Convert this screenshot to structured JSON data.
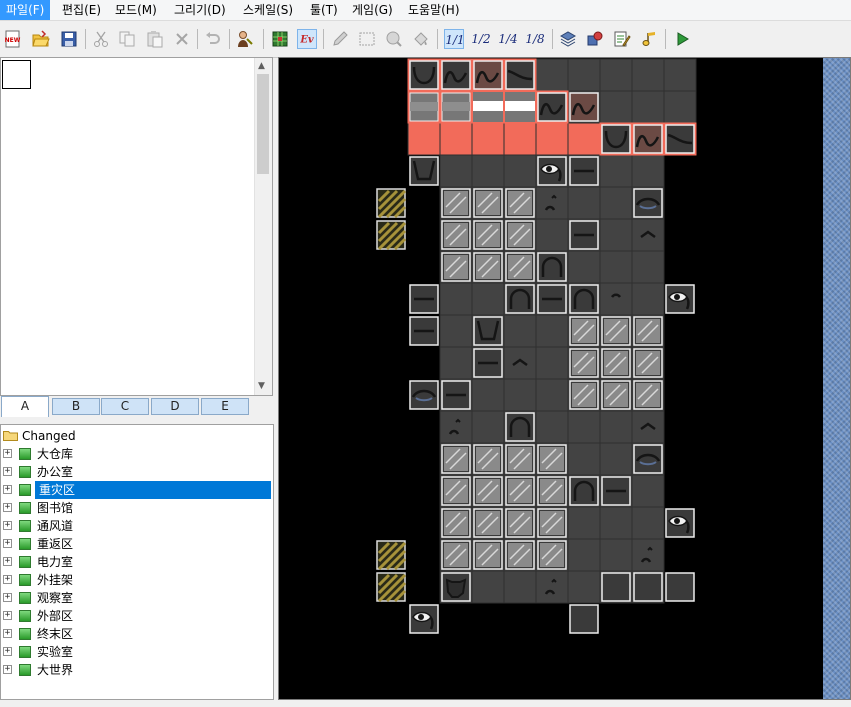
{
  "menubar": {
    "items": [
      {
        "label": "파일(F)",
        "active": true
      },
      {
        "label": "편집(E)"
      },
      {
        "label": "모드(M)"
      },
      {
        "label": "그리기(D)"
      },
      {
        "label": "스케일(S)"
      },
      {
        "label": "툴(T)"
      },
      {
        "label": "게임(G)"
      },
      {
        "label": "도움말(H)"
      }
    ]
  },
  "toolbar": {
    "new_label": "NEW",
    "event_label": "Ev",
    "scale_full": "1/1",
    "scale_half": "1/2",
    "scale_quarter": "1/4",
    "scale_eighth": "1/8"
  },
  "tabs": [
    "A",
    "B",
    "C",
    "D",
    "E"
  ],
  "tree": {
    "root": "Changed",
    "items": [
      "大仓库",
      "办公室",
      "重灾区",
      "图书馆",
      "通风道",
      "重返区",
      "电力室",
      "外挂架",
      "观察室",
      "外部区",
      "终末区",
      "实验室",
      "大世界"
    ],
    "selected_index": 2
  },
  "map": {
    "grid": {
      "cols": 9,
      "rows": 18,
      "cell": 32
    },
    "colors": {
      "background": "#000000",
      "floor": "#434343",
      "grid_line": "#2f2f2f",
      "highlight": "#f26b5a",
      "panel_stripe": "#6a8fc4"
    },
    "blank_cells": [
      [
        0,
        1
      ],
      [
        1,
        1
      ],
      [
        2,
        1
      ],
      [
        0,
        3
      ],
      [
        0,
        4
      ],
      [
        0,
        5
      ],
      [
        0,
        6
      ],
      [
        0,
        7
      ],
      [
        0,
        8
      ],
      [
        0,
        9
      ],
      [
        0,
        10
      ],
      [
        0,
        11
      ],
      [
        0,
        12
      ],
      [
        0,
        13
      ],
      [
        0,
        14
      ],
      [
        0,
        15
      ],
      [
        0,
        16
      ],
      [
        0,
        17
      ],
      [
        1,
        17
      ],
      [
        2,
        17
      ],
      [
        3,
        17
      ],
      [
        4,
        17
      ],
      [
        5,
        17
      ],
      [
        6,
        17
      ],
      [
        7,
        17
      ],
      [
        8,
        17
      ],
      [
        8,
        2
      ],
      [
        8,
        3
      ],
      [
        8,
        4
      ],
      [
        8,
        5
      ],
      [
        8,
        6
      ],
      [
        8,
        7
      ],
      [
        8,
        8
      ],
      [
        8,
        9
      ],
      [
        8,
        10
      ],
      [
        8,
        11
      ],
      [
        8,
        12
      ],
      [
        8,
        13
      ],
      [
        8,
        14
      ],
      [
        8,
        15
      ],
      [
        8,
        16
      ]
    ],
    "red_cells": [
      [
        0,
        2
      ],
      [
        1,
        2
      ],
      [
        2,
        2
      ],
      [
        3,
        2
      ],
      [
        4,
        2
      ],
      [
        5,
        2
      ]
    ],
    "tiles": [
      {
        "c": 0,
        "r": 0,
        "t": "curve-l",
        "hl": true
      },
      {
        "c": 1,
        "r": 0,
        "t": "wave",
        "hl": true
      },
      {
        "c": 2,
        "r": 0,
        "t": "wave-brown",
        "hl": true
      },
      {
        "c": 3,
        "r": 0,
        "t": "slope",
        "hl": true
      },
      {
        "c": 0,
        "r": 1,
        "t": "bar",
        "hl": true
      },
      {
        "c": 1,
        "r": 1,
        "t": "bar",
        "hl": true
      },
      {
        "c": 2,
        "r": 1,
        "t": "white-band",
        "hl": true
      },
      {
        "c": 3,
        "r": 1,
        "t": "white-band",
        "hl": true
      },
      {
        "c": 4,
        "r": 1,
        "t": "wave",
        "hl": true
      },
      {
        "c": 5,
        "r": 1,
        "t": "wave-brown",
        "hl": false
      },
      {
        "c": 6,
        "r": 2,
        "t": "curve-l",
        "hl": true
      },
      {
        "c": 7,
        "r": 2,
        "t": "wave-brown",
        "hl": true
      },
      {
        "c": 8,
        "r": 2,
        "t": "slope",
        "hl": true
      },
      {
        "c": 0,
        "r": 3,
        "t": "cup"
      },
      {
        "c": 4,
        "r": 3,
        "t": "eye"
      },
      {
        "c": 5,
        "r": 3,
        "t": "hline"
      },
      {
        "c": 1,
        "r": 4,
        "t": "glass"
      },
      {
        "c": 2,
        "r": 4,
        "t": "glass"
      },
      {
        "c": 3,
        "r": 4,
        "t": "glass"
      },
      {
        "c": 4,
        "r": 4,
        "t": "dots"
      },
      {
        "c": 7,
        "r": 4,
        "t": "dome-blue"
      },
      {
        "c": 1,
        "r": 5,
        "t": "glass"
      },
      {
        "c": 2,
        "r": 5,
        "t": "glass"
      },
      {
        "c": 3,
        "r": 5,
        "t": "glass"
      },
      {
        "c": 5,
        "r": 5,
        "t": "hline"
      },
      {
        "c": 7,
        "r": 5,
        "t": "caret"
      },
      {
        "c": 1,
        "r": 6,
        "t": "glass"
      },
      {
        "c": 2,
        "r": 6,
        "t": "glass"
      },
      {
        "c": 3,
        "r": 6,
        "t": "glass"
      },
      {
        "c": 4,
        "r": 6,
        "t": "arch"
      },
      {
        "c": 0,
        "r": 7,
        "t": "hline"
      },
      {
        "c": 3,
        "r": 7,
        "t": "arch"
      },
      {
        "c": 4,
        "r": 7,
        "t": "hline"
      },
      {
        "c": 5,
        "r": 7,
        "t": "arch"
      },
      {
        "c": 6,
        "r": 7,
        "t": "tiny-arch"
      },
      {
        "c": 8,
        "r": 7,
        "t": "eye"
      },
      {
        "c": 0,
        "r": 8,
        "t": "hline"
      },
      {
        "c": 2,
        "r": 8,
        "t": "cup"
      },
      {
        "c": 5,
        "r": 8,
        "t": "glass"
      },
      {
        "c": 6,
        "r": 8,
        "t": "glass"
      },
      {
        "c": 7,
        "r": 8,
        "t": "glass"
      },
      {
        "c": 2,
        "r": 9,
        "t": "hline"
      },
      {
        "c": 3,
        "r": 9,
        "t": "caret"
      },
      {
        "c": 5,
        "r": 9,
        "t": "glass"
      },
      {
        "c": 6,
        "r": 9,
        "t": "glass"
      },
      {
        "c": 7,
        "r": 9,
        "t": "glass"
      },
      {
        "c": 0,
        "r": 10,
        "t": "dome-blue"
      },
      {
        "c": 1,
        "r": 10,
        "t": "hline"
      },
      {
        "c": 5,
        "r": 10,
        "t": "glass"
      },
      {
        "c": 6,
        "r": 10,
        "t": "glass"
      },
      {
        "c": 7,
        "r": 10,
        "t": "glass"
      },
      {
        "c": 1,
        "r": 11,
        "t": "dots"
      },
      {
        "c": 3,
        "r": 11,
        "t": "arch"
      },
      {
        "c": 7,
        "r": 11,
        "t": "caret"
      },
      {
        "c": 1,
        "r": 12,
        "t": "glass"
      },
      {
        "c": 2,
        "r": 12,
        "t": "glass"
      },
      {
        "c": 3,
        "r": 12,
        "t": "glass"
      },
      {
        "c": 4,
        "r": 12,
        "t": "glass"
      },
      {
        "c": 7,
        "r": 12,
        "t": "dome-blue"
      },
      {
        "c": 1,
        "r": 13,
        "t": "glass"
      },
      {
        "c": 2,
        "r": 13,
        "t": "glass"
      },
      {
        "c": 3,
        "r": 13,
        "t": "glass"
      },
      {
        "c": 4,
        "r": 13,
        "t": "glass"
      },
      {
        "c": 5,
        "r": 13,
        "t": "arch"
      },
      {
        "c": 6,
        "r": 13,
        "t": "hline"
      },
      {
        "c": 1,
        "r": 14,
        "t": "glass"
      },
      {
        "c": 2,
        "r": 14,
        "t": "glass"
      },
      {
        "c": 3,
        "r": 14,
        "t": "glass"
      },
      {
        "c": 4,
        "r": 14,
        "t": "glass"
      },
      {
        "c": 8,
        "r": 14,
        "t": "eye"
      },
      {
        "c": 1,
        "r": 15,
        "t": "glass"
      },
      {
        "c": 2,
        "r": 15,
        "t": "glass"
      },
      {
        "c": 3,
        "r": 15,
        "t": "glass"
      },
      {
        "c": 4,
        "r": 15,
        "t": "glass"
      },
      {
        "c": 7,
        "r": 15,
        "t": "dots"
      },
      {
        "c": 1,
        "r": 16,
        "t": "blob"
      },
      {
        "c": 4,
        "r": 16,
        "t": "dots"
      },
      {
        "c": 6,
        "r": 16,
        "t": "empty-box"
      },
      {
        "c": 7,
        "r": 16,
        "t": "empty-box"
      },
      {
        "c": 8,
        "r": 16,
        "t": "empty-box"
      },
      {
        "c": 0,
        "r": 17,
        "t": "eye"
      },
      {
        "c": 5,
        "r": 17,
        "t": "empty-box"
      }
    ],
    "outside_tiles": [
      {
        "c": -1,
        "r": 4,
        "t": "stripes"
      },
      {
        "c": -1,
        "r": 5,
        "t": "stripes"
      },
      {
        "c": -1,
        "r": 15,
        "t": "stripes"
      },
      {
        "c": -1,
        "r": 16,
        "t": "stripes"
      }
    ]
  }
}
